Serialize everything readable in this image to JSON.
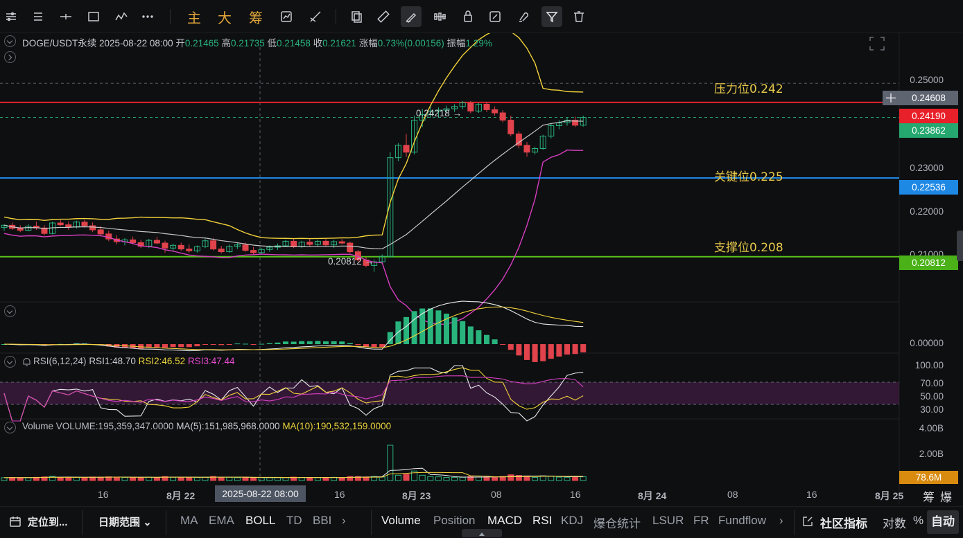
{
  "toolbar": {
    "chars": [
      "主",
      "大",
      "筹"
    ]
  },
  "header": {
    "symbol": "DOGE/USDT永续",
    "datetime": "2025-08-22 08:00",
    "open_label": "开",
    "open_value": "0.21465",
    "high_label": "高",
    "high_value": "0.21735",
    "low_label": "低",
    "low_value": "0.21458",
    "close_label": "收",
    "close_value": "0.21621",
    "change_label": "涨幅",
    "change_value": "0.73%(0.00156)",
    "amplitude_label": "振幅",
    "amplitude_value": "1.29%"
  },
  "price_axis": [
    "0.25000",
    "0.23000",
    "0.22000",
    "0.21000"
  ],
  "price_tags": {
    "crosshair": "0.24608",
    "red_line": "0.24190",
    "last_price": "0.23862",
    "blue_line": "0.22536",
    "green_line": "0.20812"
  },
  "level_notes": {
    "resistance": "压力位0.242",
    "key": "关键位0.225",
    "support": "支撑位0.208"
  },
  "chart_annotations": {
    "high_marker": "0.24218",
    "low_marker": "0.20812"
  },
  "macd_axis": [
    "0.00000"
  ],
  "rsi": {
    "title": "RSI(6,12,24)",
    "rsi1": "RSI1:48.70",
    "rsi2": "RSI2:46.52",
    "rsi3": "RSI3:47.44",
    "axis": [
      "100.00",
      "70.00",
      "50.00",
      "30.00"
    ]
  },
  "volume": {
    "title": "Volume",
    "volume": "VOLUME:195,359,347.0000",
    "ma5": "MA(5):151,985,968.0000",
    "ma10": "MA(10):190,532,159.0000",
    "axis": [
      "4.00B",
      "2.00B"
    ],
    "tag": "78.6M"
  },
  "time_axis": {
    "labels": [
      "16",
      "8月 22",
      "16",
      "8月 23",
      "08",
      "16",
      "8月 24",
      "08",
      "16",
      "8月 25"
    ],
    "crosshair": "2025-08-22 08:00",
    "right_items": [
      "筹",
      "爆"
    ]
  },
  "bottom_bar": {
    "locate": "定位到...",
    "date_range": "日期范围",
    "main_indicators": [
      "MA",
      "EMA",
      "BOLL",
      "TD",
      "BBI"
    ],
    "sub_indicators": [
      "Volume",
      "Position",
      "MACD",
      "RSI",
      "KDJ",
      "爆仓统计",
      "LSUR",
      "FR",
      "Fundflow"
    ],
    "community": "社区指标",
    "log": "对数",
    "percent": "%",
    "auto": "自动"
  },
  "colors": {
    "up": "#29b47e",
    "down": "#e0434b",
    "red_line": "#e8202a",
    "blue_line": "#1e88e5",
    "green_line": "#58c21a",
    "boll_upper": "#f2d23a",
    "boll_mid": "#c9c9c9",
    "boll_lower": "#d63fc0"
  },
  "chart_data": {
    "type": "candlestick",
    "symbol": "DOGE/USDT永续",
    "y_range": [
      0.2055,
      0.254
    ],
    "candles_ohlc": [
      [
        0.2145,
        0.2152,
        0.2138,
        0.215
      ],
      [
        0.215,
        0.2156,
        0.214,
        0.2143
      ],
      [
        0.2143,
        0.215,
        0.2135,
        0.2139
      ],
      [
        0.2139,
        0.2152,
        0.2137,
        0.2148
      ],
      [
        0.2148,
        0.2158,
        0.214,
        0.2144
      ],
      [
        0.2144,
        0.215,
        0.2128,
        0.2132
      ],
      [
        0.2132,
        0.2158,
        0.213,
        0.2155
      ],
      [
        0.2155,
        0.2162,
        0.2148,
        0.2151
      ],
      [
        0.2151,
        0.2158,
        0.214,
        0.2146
      ],
      [
        0.2146,
        0.216,
        0.2143,
        0.2157
      ],
      [
        0.2157,
        0.2162,
        0.2145,
        0.2149
      ],
      [
        0.2149,
        0.2156,
        0.2135,
        0.214
      ],
      [
        0.214,
        0.2148,
        0.2128,
        0.2131
      ],
      [
        0.2131,
        0.2138,
        0.2115,
        0.212
      ],
      [
        0.212,
        0.2128,
        0.2108,
        0.2114
      ],
      [
        0.2114,
        0.2122,
        0.2106,
        0.2118
      ],
      [
        0.2118,
        0.2125,
        0.2108,
        0.2112
      ],
      [
        0.2112,
        0.2118,
        0.21,
        0.2104
      ],
      [
        0.2104,
        0.212,
        0.21,
        0.2117
      ],
      [
        0.2117,
        0.2125,
        0.2108,
        0.2111
      ],
      [
        0.2111,
        0.2116,
        0.209,
        0.21
      ],
      [
        0.21,
        0.211,
        0.2092,
        0.2106
      ],
      [
        0.2106,
        0.2112,
        0.2094,
        0.2098
      ],
      [
        0.2098,
        0.2108,
        0.209,
        0.2094
      ],
      [
        0.2094,
        0.2106,
        0.209,
        0.2103
      ],
      [
        0.2103,
        0.212,
        0.21,
        0.2116
      ],
      [
        0.2116,
        0.2122,
        0.2095,
        0.2098
      ],
      [
        0.2098,
        0.2105,
        0.2088,
        0.2092
      ],
      [
        0.2092,
        0.2108,
        0.209,
        0.2104
      ],
      [
        0.2104,
        0.2112,
        0.2098,
        0.2107
      ],
      [
        0.2107,
        0.2112,
        0.2092,
        0.2095
      ],
      [
        0.2095,
        0.2102,
        0.2086,
        0.209
      ],
      [
        0.209,
        0.21,
        0.2086,
        0.2097
      ],
      [
        0.2097,
        0.2106,
        0.2092,
        0.2102
      ],
      [
        0.2102,
        0.211,
        0.2096,
        0.2105
      ],
      [
        0.2105,
        0.2118,
        0.2102,
        0.2115
      ],
      [
        0.2115,
        0.212,
        0.21,
        0.2103
      ],
      [
        0.2103,
        0.2116,
        0.21,
        0.2113
      ],
      [
        0.2113,
        0.212,
        0.2104,
        0.2108
      ],
      [
        0.2108,
        0.2118,
        0.2104,
        0.2115
      ],
      [
        0.2115,
        0.212,
        0.2104,
        0.2107
      ],
      [
        0.2107,
        0.2118,
        0.21,
        0.2114
      ],
      [
        0.2114,
        0.212,
        0.2108,
        0.2111
      ],
      [
        0.2111,
        0.2114,
        0.2088,
        0.2092
      ],
      [
        0.2092,
        0.2096,
        0.207,
        0.2074
      ],
      [
        0.2074,
        0.208,
        0.2058,
        0.2062
      ],
      [
        0.2062,
        0.2075,
        0.2048,
        0.207
      ],
      [
        0.207,
        0.2086,
        0.2065,
        0.2082
      ],
      [
        0.2082,
        0.231,
        0.208,
        0.2298
      ],
      [
        0.2298,
        0.233,
        0.229,
        0.2325
      ],
      [
        0.2325,
        0.235,
        0.23,
        0.231
      ],
      [
        0.231,
        0.239,
        0.2305,
        0.238
      ],
      [
        0.238,
        0.2405,
        0.2365,
        0.2392
      ],
      [
        0.2392,
        0.241,
        0.2385,
        0.24
      ],
      [
        0.24,
        0.2408,
        0.2385,
        0.2402
      ],
      [
        0.2402,
        0.2412,
        0.2395,
        0.2405
      ],
      [
        0.2405,
        0.2415,
        0.2398,
        0.241
      ],
      [
        0.241,
        0.2422,
        0.2404,
        0.2418
      ],
      [
        0.2418,
        0.2422,
        0.2395,
        0.24
      ],
      [
        0.24,
        0.2418,
        0.2396,
        0.2415
      ],
      [
        0.2415,
        0.242,
        0.2398,
        0.2403
      ],
      [
        0.2403,
        0.241,
        0.239,
        0.2396
      ],
      [
        0.2396,
        0.2402,
        0.2375,
        0.238
      ],
      [
        0.238,
        0.239,
        0.2345,
        0.235
      ],
      [
        0.235,
        0.2356,
        0.2318,
        0.2325
      ],
      [
        0.2325,
        0.2332,
        0.23,
        0.231
      ],
      [
        0.231,
        0.2322,
        0.2305,
        0.2318
      ],
      [
        0.2318,
        0.2348,
        0.2315,
        0.2345
      ],
      [
        0.2345,
        0.2372,
        0.234,
        0.2368
      ],
      [
        0.2368,
        0.238,
        0.236,
        0.2374
      ],
      [
        0.2374,
        0.2386,
        0.2368,
        0.238
      ],
      [
        0.238,
        0.2388,
        0.2365,
        0.2369
      ],
      [
        0.2369,
        0.239,
        0.2366,
        0.2386
      ]
    ],
    "horizontal_levels": [
      0.24608,
      0.2419,
      0.23862,
      0.22536,
      0.20812
    ],
    "indicators": [
      "BOLL",
      "MACD",
      "RSI(6,12,24)",
      "VOLUME",
      "MA(5)",
      "MA(10)"
    ]
  }
}
